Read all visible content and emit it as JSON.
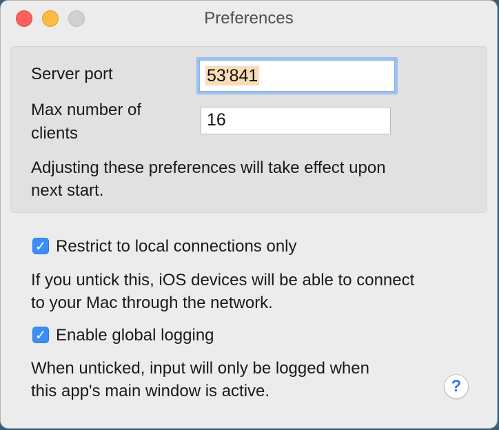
{
  "window": {
    "title": "Preferences"
  },
  "server": {
    "port_label": "Server port",
    "port_value": "53'841",
    "max_clients_label_line1": "Max number of",
    "max_clients_label_line2": "clients",
    "max_clients_value": "16",
    "note_line1": "Adjusting these preferences will take effect upon",
    "note_line2": "next start."
  },
  "options": {
    "restrict": {
      "checked": true,
      "label": "Restrict to local connections only",
      "desc_line1": "If you untick this, iOS devices will be able to connect",
      "desc_line2": "to your Mac through the network."
    },
    "logging": {
      "checked": true,
      "label": "Enable global logging",
      "desc_line1": "When unticked, input will only be logged when",
      "desc_line2": "this app's main window is active."
    }
  },
  "help": {
    "glyph": "?",
    "icon": "help-icon"
  },
  "colors": {
    "accent": "#3b8ef7",
    "focus_ring": "#9cc1f1",
    "selection": "#fcdcb6"
  }
}
